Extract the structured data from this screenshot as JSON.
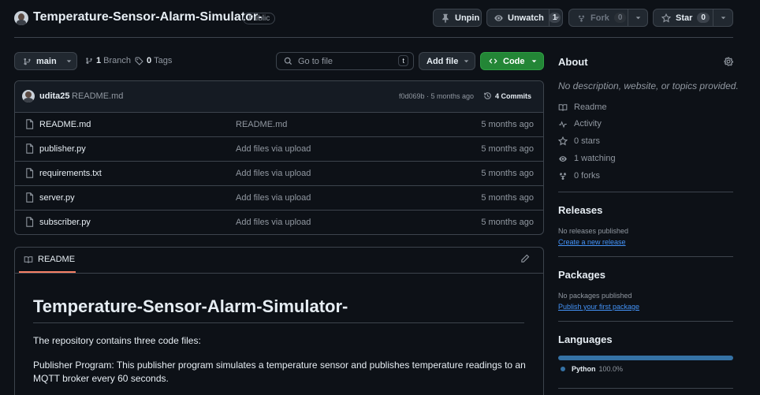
{
  "repo": {
    "name": "Temperature-Sensor-Alarm-Simulator-",
    "visibility": "Public"
  },
  "header_actions": {
    "unpin_label": "Unpin",
    "unwatch_label": "Unwatch",
    "watch_count": "1",
    "fork_label": "Fork",
    "fork_count": "0",
    "star_label": "Star",
    "star_count": "0"
  },
  "toolbar": {
    "branch_name": "main",
    "branch_count": "1",
    "branch_label": "Branch",
    "tag_count": "0",
    "tag_label": "Tags",
    "search_placeholder": "Go to file",
    "search_shortcut": "t",
    "add_file_label": "Add file",
    "code_label": "Code"
  },
  "commit": {
    "author": "udita25",
    "message": "README.md",
    "hash_time": "f0d069b · 5 months ago",
    "commit_count": "4 Commits"
  },
  "files": [
    {
      "name": "README.md",
      "message": "README.md",
      "date": "5 months ago"
    },
    {
      "name": "publisher.py",
      "message": "Add files via upload",
      "date": "5 months ago"
    },
    {
      "name": "requirements.txt",
      "message": "Add files via upload",
      "date": "5 months ago"
    },
    {
      "name": "server.py",
      "message": "Add files via upload",
      "date": "5 months ago"
    },
    {
      "name": "subscriber.py",
      "message": "Add files via upload",
      "date": "5 months ago"
    }
  ],
  "readme": {
    "tab_label": "README",
    "heading": "Temperature-Sensor-Alarm-Simulator-",
    "para1": "The repository contains three code files:",
    "para2": "Publisher Program: This publisher program simulates a temperature sensor and publishes temperature readings to an MQTT broker every 60 seconds."
  },
  "about": {
    "title": "About",
    "description": "No description, website, or topics provided.",
    "items": [
      {
        "icon": "book-icon",
        "label": "Readme"
      },
      {
        "icon": "pulse-icon",
        "label": "Activity"
      },
      {
        "icon": "star-icon",
        "label": "0 stars"
      },
      {
        "icon": "eye-icon",
        "label": "1 watching"
      },
      {
        "icon": "fork-icon",
        "label": "0 forks"
      }
    ]
  },
  "releases": {
    "title": "Releases",
    "empty_text": "No releases published",
    "link": "Create a new release"
  },
  "packages": {
    "title": "Packages",
    "empty_text": "No packages published",
    "link": "Publish your first package"
  },
  "languages": {
    "title": "Languages",
    "items": [
      {
        "name": "Python",
        "percent": "100.0%",
        "fraction": 1.0,
        "color": "#3572A5"
      }
    ]
  },
  "colors": {
    "code_button": "#238636",
    "accent_link": "#4493f8",
    "tab_underline": "#f78166"
  }
}
